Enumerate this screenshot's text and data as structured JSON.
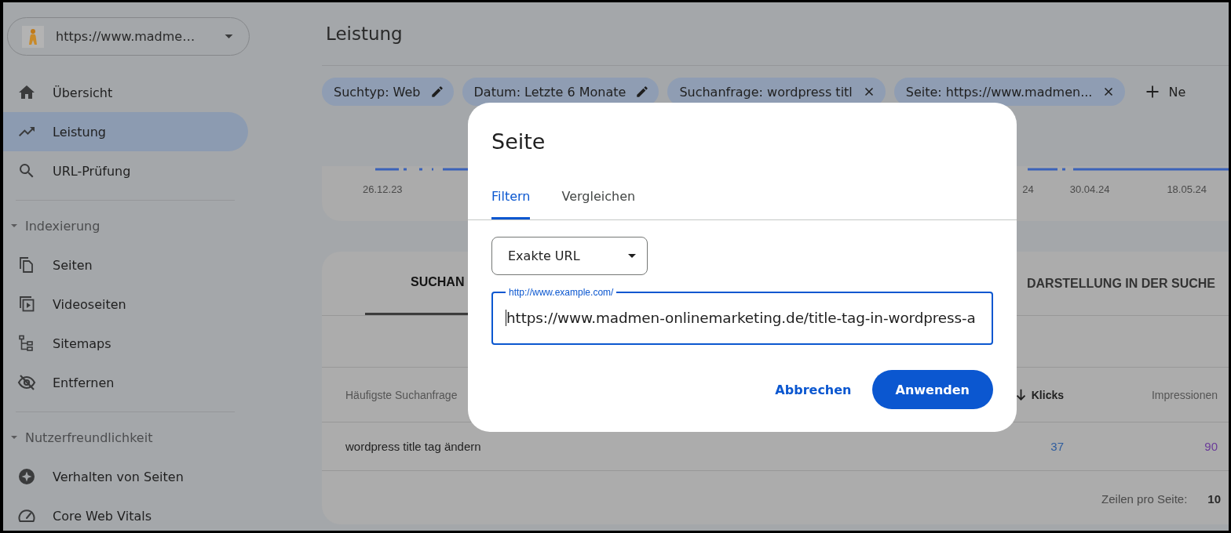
{
  "property_selector": {
    "label": "https://www.madme…"
  },
  "sidebar": {
    "groups": [
      {
        "items": [
          {
            "label": "Übersicht",
            "selected": false
          },
          {
            "label": "Leistung",
            "selected": true
          },
          {
            "label": "URL-Prüfung",
            "selected": false
          }
        ]
      },
      {
        "heading": "Indexierung",
        "expanded": true,
        "items": [
          {
            "label": "Seiten",
            "selected": false
          },
          {
            "label": "Videoseiten",
            "selected": false
          },
          {
            "label": "Sitemaps",
            "selected": false
          },
          {
            "label": "Entfernen",
            "selected": false
          }
        ]
      },
      {
        "heading": "Nutzerfreundlichkeit",
        "expanded": true,
        "items": [
          {
            "label": "Verhalten von Seiten",
            "selected": false
          },
          {
            "label": "Core Web Vitals",
            "selected": false
          }
        ]
      }
    ]
  },
  "page": {
    "title": "Leistung",
    "filters": [
      {
        "label": "Suchtyp: Web",
        "kind": "edit"
      },
      {
        "label": "Datum: Letzte 6 Monate",
        "kind": "edit"
      },
      {
        "label": "Suchanfrage: wordpress titl",
        "kind": "remove"
      },
      {
        "label": "Seite: https://www.madmen...",
        "kind": "remove"
      }
    ],
    "new_filter": {
      "label": "Ne"
    },
    "chart": {
      "x_labels": [
        "26.12.23",
        "24",
        "30.04.24",
        "18.05.24"
      ]
    },
    "table": {
      "tabs": [
        {
          "label": "SUCHAN",
          "selected": true
        },
        {
          "label": "DARSTELLUNG IN DER SUCHE",
          "selected": false
        }
      ],
      "columns": [
        {
          "label": "Häufigste Suchanfrage",
          "sorted": false
        },
        {
          "label": "Klicks",
          "sorted": true
        },
        {
          "label": "Impressionen",
          "sorted": false
        }
      ],
      "rows": [
        {
          "query": "wordpress title tag ändern",
          "clicks": "37",
          "impressions": "90"
        }
      ],
      "footer": {
        "rows_per_page_label": "Zeilen pro Seite:",
        "rows_per_page": "10"
      }
    }
  },
  "dialog": {
    "title": "Seite",
    "tabs": [
      {
        "label": "Filtern",
        "selected": true
      },
      {
        "label": "Vergleichen",
        "selected": false
      }
    ],
    "match_type": "Exakte URL",
    "url_field": {
      "label": "http://www.example.com/",
      "value": "https://www.madmen-onlinemarketing.de/title-tag-in-wordpress-a"
    },
    "buttons": [
      {
        "label": "Abbrechen",
        "kind": "text"
      },
      {
        "label": "Anwenden",
        "kind": "filled"
      }
    ]
  }
}
